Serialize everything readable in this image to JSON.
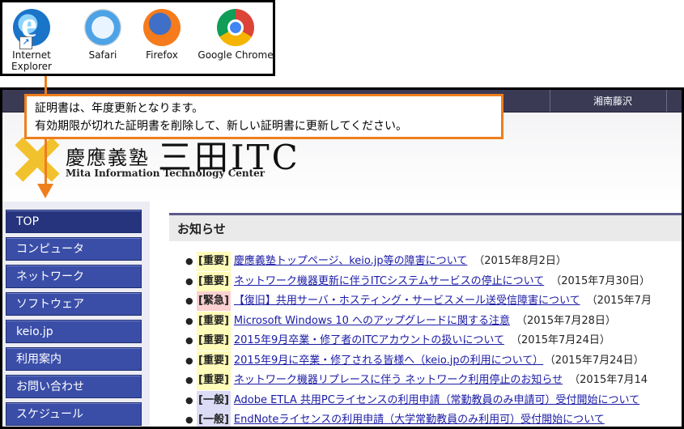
{
  "browsers": [
    {
      "name": "Internet Explorer",
      "line1": "Internet",
      "line2": "Explorer",
      "icon": "internet-explorer-icon"
    },
    {
      "name": "Safari",
      "icon": "safari-icon"
    },
    {
      "name": "Firefox",
      "icon": "firefox-icon"
    },
    {
      "name": "Google Chrome",
      "icon": "chrome-icon"
    }
  ],
  "callout": {
    "line1": "証明書は、年度更新となります。",
    "line2": "有効期限が切れた証明書を削除して、新しい証明書に更新してください。"
  },
  "topnav": {
    "campus": "湘南藤沢"
  },
  "header": {
    "name_ja": "慶應義塾",
    "name_big": "三田ITC",
    "name_en": "Mita Information Technology Center"
  },
  "sidebar": {
    "items": [
      {
        "label": "TOP",
        "active": true
      },
      {
        "label": "コンピュータ"
      },
      {
        "label": "ネットワーク"
      },
      {
        "label": "ソフトウェア"
      },
      {
        "label": "keio.jp"
      },
      {
        "label": "利用案内"
      },
      {
        "label": "お問い合わせ"
      },
      {
        "label": "スケジュール"
      }
    ]
  },
  "main": {
    "title": "お知らせ",
    "news": [
      {
        "tag": "[重要]",
        "type": "important",
        "title": "慶應義塾トップページ、keio.jp等の障害について",
        "date": "（2015年8月2日）"
      },
      {
        "tag": "[重要]",
        "type": "important",
        "title": "ネットワーク機器更新に伴うITCシステムサービスの停止について",
        "date": "（2015年7月30日）"
      },
      {
        "tag": "[緊急]",
        "type": "urgent",
        "title": "【復旧】共用サーバ・ホスティング・サービスメール送受信障害について",
        "date": "（2015年7月"
      },
      {
        "tag": "[重要]",
        "type": "important",
        "title": "Microsoft Windows 10 へのアップグレードに関する注意",
        "date": "（2015年7月28日）"
      },
      {
        "tag": "[重要]",
        "type": "important",
        "title": "2015年9月卒業・修了者のITCアカウントの扱いについて",
        "date": "（2015年7月24日）"
      },
      {
        "tag": "[重要]",
        "type": "important",
        "title": "2015年9月に卒業・修了される皆様へ（keio.jpの利用について）",
        "date": "（2015年7月24日）"
      },
      {
        "tag": "[重要]",
        "type": "important",
        "title": "ネットワーク機器リプレースに伴う ネットワーク利用停止のお知らせ",
        "date": "（2015年7月14"
      },
      {
        "tag": "[一般]",
        "type": "general",
        "title": "Adobe ETLA 共用PCライセンスの利用申請（常勤教員のみ申請可）受付開始について",
        "date": ""
      },
      {
        "tag": "[一般]",
        "type": "general",
        "title": "EndNoteライセンスの利用申請（大学常勤教員のみ利用可）受付開始について",
        "date": ""
      }
    ]
  },
  "colors": {
    "accent_orange": "#ef7e1d",
    "sidebar_blue": "#3a4ea8",
    "link": "#1a1aa6"
  }
}
